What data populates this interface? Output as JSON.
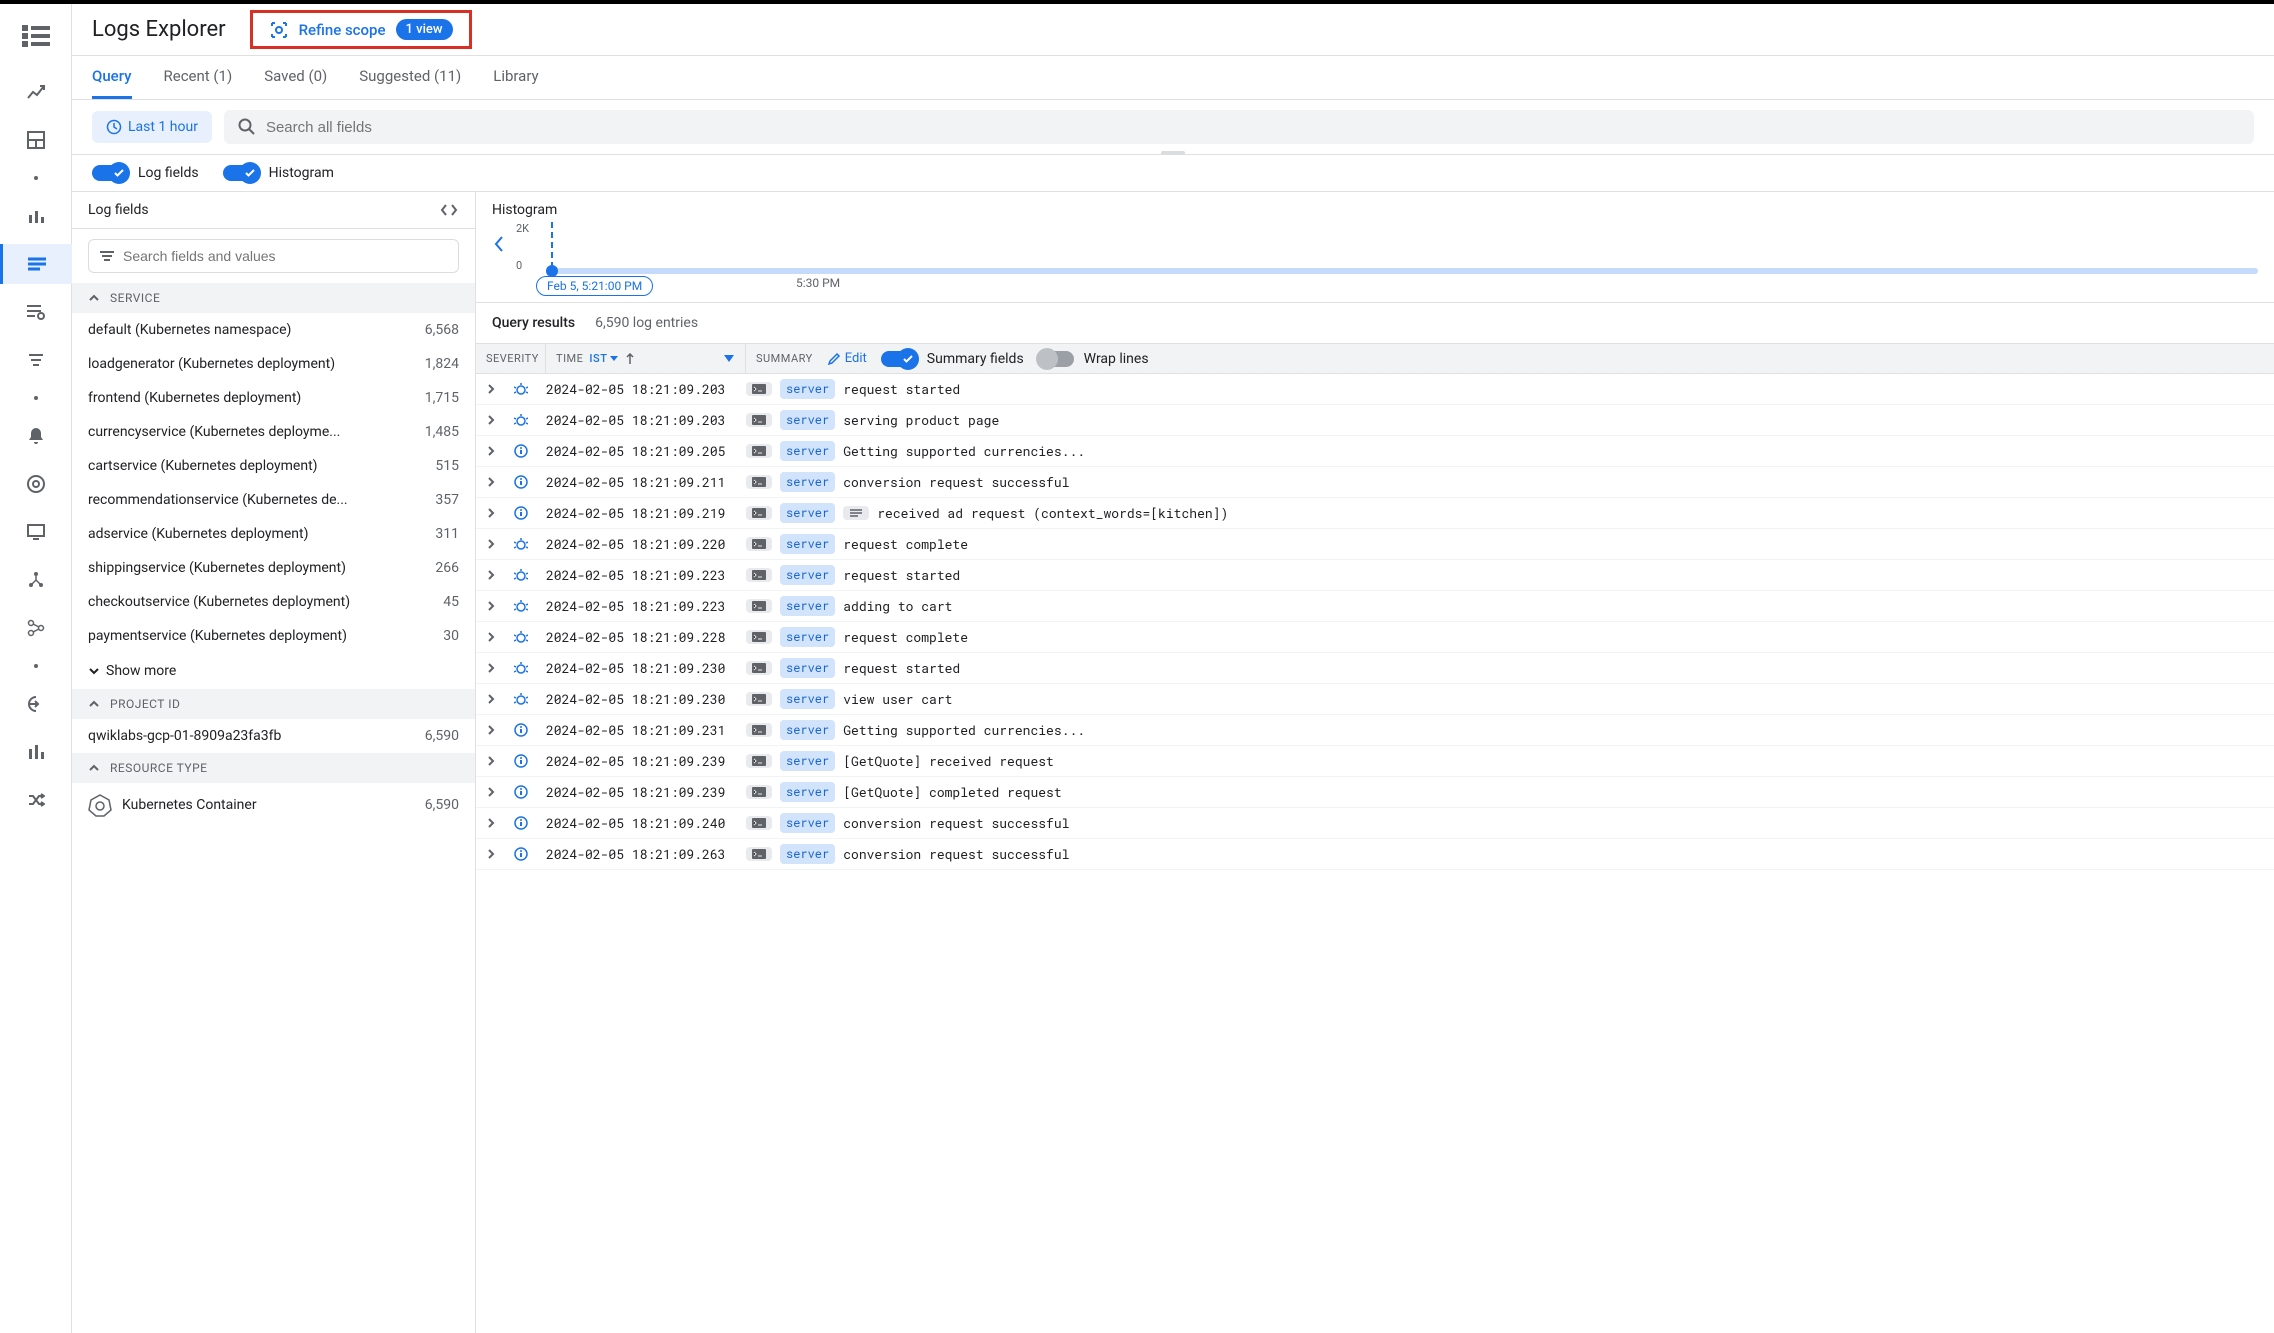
{
  "page_title": "Logs Explorer",
  "refine_scope": {
    "label": "Refine scope",
    "badge": "1 view"
  },
  "tabs": [
    {
      "label": "Query",
      "active": true
    },
    {
      "label": "Recent (1)"
    },
    {
      "label": "Saved (0)"
    },
    {
      "label": "Suggested (11)"
    },
    {
      "label": "Library"
    }
  ],
  "time_range": "Last 1 hour",
  "search_placeholder": "Search all fields",
  "toggles": {
    "log_fields": "Log fields",
    "histogram": "Histogram"
  },
  "fields_panel": {
    "title": "Log fields",
    "search_placeholder": "Search fields and values",
    "groups": [
      {
        "name": "SERVICE",
        "items": [
          {
            "label": "default (Kubernetes namespace)",
            "count": "6,568"
          },
          {
            "label": "loadgenerator (Kubernetes deployment)",
            "count": "1,824"
          },
          {
            "label": "frontend (Kubernetes deployment)",
            "count": "1,715"
          },
          {
            "label": "currencyservice (Kubernetes deployme...",
            "count": "1,485"
          },
          {
            "label": "cartservice (Kubernetes deployment)",
            "count": "515"
          },
          {
            "label": "recommendationservice (Kubernetes de...",
            "count": "357"
          },
          {
            "label": "adservice (Kubernetes deployment)",
            "count": "311"
          },
          {
            "label": "shippingservice (Kubernetes deployment)",
            "count": "266"
          },
          {
            "label": "checkoutservice (Kubernetes deployment)",
            "count": "45"
          },
          {
            "label": "paymentservice (Kubernetes deployment)",
            "count": "30"
          }
        ],
        "show_more": "Show more"
      },
      {
        "name": "PROJECT ID",
        "items": [
          {
            "label": "qwiklabs-gcp-01-8909a23fa3fb",
            "count": "6,590"
          }
        ]
      },
      {
        "name": "RESOURCE TYPE",
        "items": [
          {
            "label": "Kubernetes Container",
            "count": "6,590",
            "icon": "k8s"
          }
        ]
      }
    ]
  },
  "histogram": {
    "title": "Histogram",
    "y_max": "2K",
    "y_min": "0",
    "bubble": "Feb 5, 5:21:00 PM",
    "x_label_1": "5:30 PM"
  },
  "results": {
    "title": "Query results",
    "count": "6,590 log entries",
    "columns": {
      "severity": "SEVERITY",
      "time": "TIME",
      "tz": "IST",
      "summary": "SUMMARY",
      "edit": "Edit",
      "summary_fields": "Summary fields",
      "wrap_lines": "Wrap lines"
    },
    "rows": [
      {
        "sev": "debug",
        "time": "2024-02-05 18:21:09.203",
        "tag": "server",
        "msg": "request started"
      },
      {
        "sev": "debug",
        "time": "2024-02-05 18:21:09.203",
        "tag": "server",
        "msg": "serving product page"
      },
      {
        "sev": "info",
        "time": "2024-02-05 18:21:09.205",
        "tag": "server",
        "msg": "Getting supported currencies..."
      },
      {
        "sev": "info",
        "time": "2024-02-05 18:21:09.211",
        "tag": "server",
        "msg": "conversion request successful"
      },
      {
        "sev": "info",
        "time": "2024-02-05 18:21:09.219",
        "tag": "server",
        "msg": "received ad request (context_words=[kitchen])",
        "extra_chip": true
      },
      {
        "sev": "debug",
        "time": "2024-02-05 18:21:09.220",
        "tag": "server",
        "msg": "request complete"
      },
      {
        "sev": "debug",
        "time": "2024-02-05 18:21:09.223",
        "tag": "server",
        "msg": "request started"
      },
      {
        "sev": "debug",
        "time": "2024-02-05 18:21:09.223",
        "tag": "server",
        "msg": "adding to cart"
      },
      {
        "sev": "debug",
        "time": "2024-02-05 18:21:09.228",
        "tag": "server",
        "msg": "request complete"
      },
      {
        "sev": "debug",
        "time": "2024-02-05 18:21:09.230",
        "tag": "server",
        "msg": "request started"
      },
      {
        "sev": "debug",
        "time": "2024-02-05 18:21:09.230",
        "tag": "server",
        "msg": "view user cart"
      },
      {
        "sev": "info",
        "time": "2024-02-05 18:21:09.231",
        "tag": "server",
        "msg": "Getting supported currencies..."
      },
      {
        "sev": "info",
        "time": "2024-02-05 18:21:09.239",
        "tag": "server",
        "msg": "[GetQuote] received request"
      },
      {
        "sev": "info",
        "time": "2024-02-05 18:21:09.239",
        "tag": "server",
        "msg": "[GetQuote] completed request"
      },
      {
        "sev": "info",
        "time": "2024-02-05 18:21:09.240",
        "tag": "server",
        "msg": "conversion request successful"
      },
      {
        "sev": "info",
        "time": "2024-02-05 18:21:09.263",
        "tag": "server",
        "msg": "conversion request successful"
      }
    ]
  }
}
